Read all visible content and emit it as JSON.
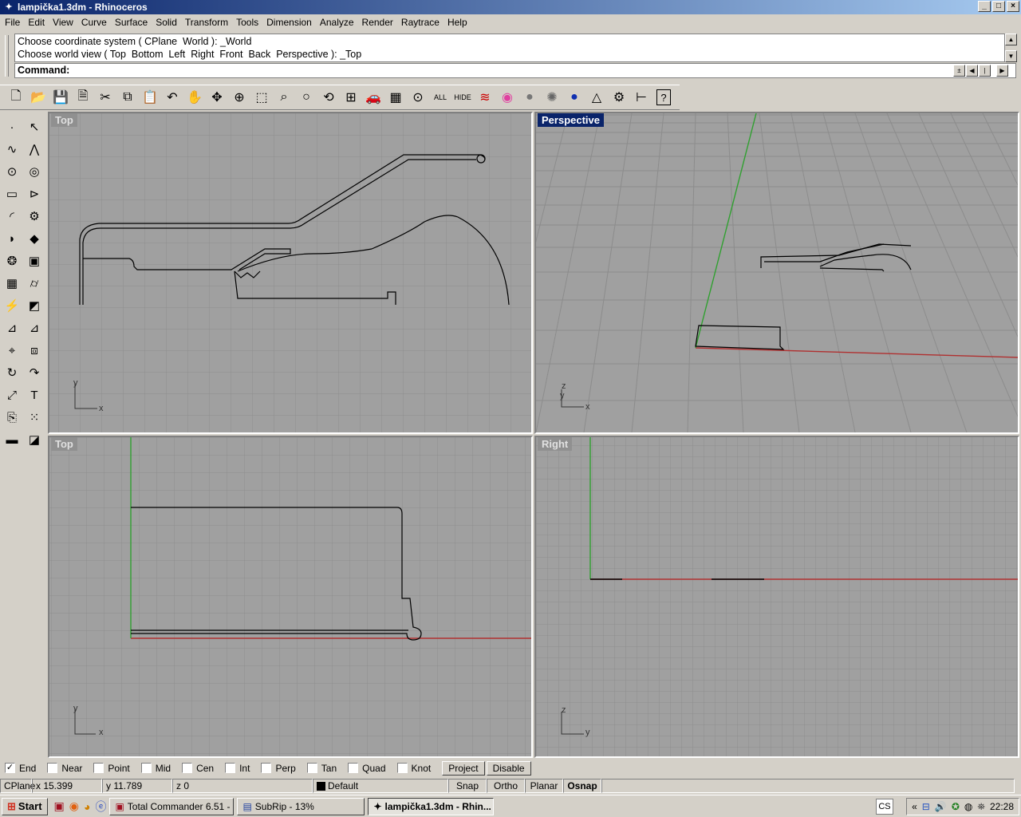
{
  "window": {
    "title": "lampička1.3dm - Rhinoceros",
    "min": "_",
    "max": "□",
    "close": "×"
  },
  "menu": [
    "File",
    "Edit",
    "View",
    "Curve",
    "Surface",
    "Solid",
    "Transform",
    "Tools",
    "Dimension",
    "Analyze",
    "Render",
    "Raytrace",
    "Help"
  ],
  "command": {
    "history": [
      "Choose coordinate system ( CPlane  World ): _World",
      "Choose world view ( Top  Bottom  Left  Right  Front  Back  Perspective ): _Top"
    ],
    "prompt": "Command:"
  },
  "toolbar_icons": [
    "new-icon",
    "open-icon",
    "save-icon",
    "print-icon",
    "cut-icon",
    "copy-icon",
    "paste-icon",
    "undo-icon",
    "pan-icon",
    "rotate-view-icon",
    "zoom-dynamic-icon",
    "zoom-window-icon",
    "zoom-extents-icon",
    "zoom-selected-icon",
    "undo-view-icon",
    "four-viewports-icon",
    "car-icon",
    "grid-icon",
    "point-icon",
    "all-text",
    "hide-text",
    "layers-icon",
    "color-wheel-icon",
    "shade-icon",
    "render-icon",
    "sphere-icon",
    "light-icon",
    "options-icon",
    "dimension-icon",
    "help-icon"
  ],
  "toolbar_text": {
    "all": "ALL",
    "hide": "HIDE",
    "help": "?"
  },
  "viewports": {
    "top_left": {
      "label": "Top",
      "axis_v": "y",
      "axis_h": "x"
    },
    "top_right": {
      "label": "Perspective",
      "axis_v": "z",
      "axis_v2": "y",
      "axis_h": "x"
    },
    "bottom_left": {
      "label": "Top",
      "axis_v": "y",
      "axis_h": "x"
    },
    "bottom_right": {
      "label": "Right",
      "axis_v": "z",
      "axis_h": "y"
    }
  },
  "osnap": [
    {
      "label": "End",
      "checked": true
    },
    {
      "label": "Near",
      "checked": false
    },
    {
      "label": "Point",
      "checked": false
    },
    {
      "label": "Mid",
      "checked": false
    },
    {
      "label": "Cen",
      "checked": false
    },
    {
      "label": "Int",
      "checked": false
    },
    {
      "label": "Perp",
      "checked": false
    },
    {
      "label": "Tan",
      "checked": false
    },
    {
      "label": "Quad",
      "checked": false
    },
    {
      "label": "Knot",
      "checked": false
    }
  ],
  "osnap_buttons": {
    "project": "Project",
    "disable": "Disable"
  },
  "status": {
    "cplane": "CPlane",
    "x": "x 15.399",
    "y": "y 11.789",
    "z": "z 0",
    "layer": "Default",
    "snap": "Snap",
    "ortho": "Ortho",
    "planar": "Planar",
    "osnap": "Osnap"
  },
  "taskbar": {
    "start": "Start",
    "tasks": [
      "Total Commander 6.51 - ...",
      "SubRip - 13%",
      "lampička1.3dm - Rhin..."
    ],
    "lang": "CS",
    "clock": "22:28",
    "tray_expand": "«"
  },
  "colors": {
    "title_start": "#0a246a",
    "viewport_bg": "#a0a0a0",
    "grid": "#8c8c8c",
    "x_axis": "#b03030",
    "y_axis": "#30a030"
  }
}
